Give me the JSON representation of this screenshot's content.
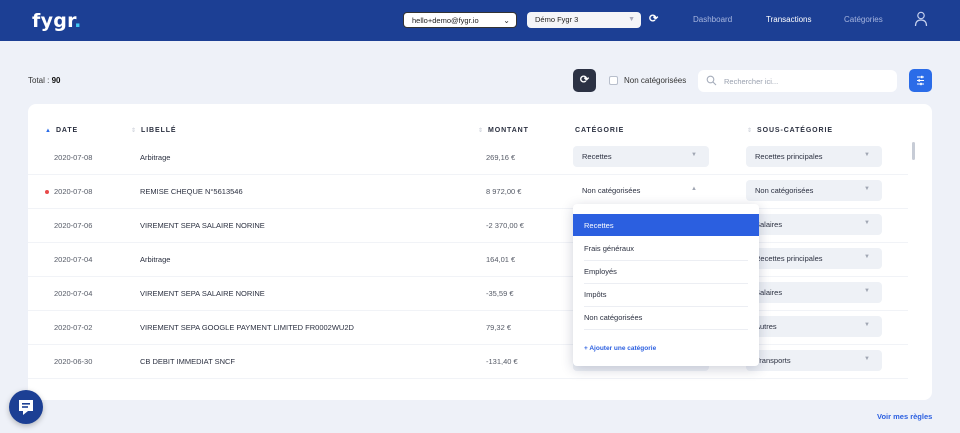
{
  "header": {
    "logo": "fygr",
    "logo_dot": ".",
    "user_select": "hello+demo@fygr.io",
    "org_select": "Démo Fygr 3",
    "nav": [
      "Dashboard",
      "Transactions",
      "Catégories"
    ],
    "active_nav": "Transactions"
  },
  "toolbar": {
    "total_label": "Total :",
    "total_value": "90",
    "uncategorized_label": "Non catégorisées",
    "search_placeholder": "Rechercher ici..."
  },
  "table": {
    "columns": [
      "DATE",
      "LIBELLÉ",
      "MONTANT",
      "CATÉGORIE",
      "SOUS-CATÉGORIE"
    ],
    "rows": [
      {
        "date": "2020-07-08",
        "label": "Arbitrage",
        "amount": "269,16 €",
        "category": "Recettes",
        "subcategory": "Recettes principales"
      },
      {
        "date": "2020-07-08",
        "label": "REMISE CHEQUE N°5613546",
        "amount": "8 972,00 €",
        "category": "Non catégorisées",
        "subcategory": "Non catégorisées"
      },
      {
        "date": "2020-07-06",
        "label": "VIREMENT SEPA SALAIRE NORINE",
        "amount": "-2 370,00 €",
        "category": "",
        "subcategory": "Salaires"
      },
      {
        "date": "2020-07-04",
        "label": "Arbitrage",
        "amount": "164,01 €",
        "category": "",
        "subcategory": "Recettes principales"
      },
      {
        "date": "2020-07-04",
        "label": "VIREMENT SEPA SALAIRE NORINE",
        "amount": "-35,59 €",
        "category": "",
        "subcategory": "Salaires"
      },
      {
        "date": "2020-07-02",
        "label": "VIREMENT SEPA GOOGLE PAYMENT LIMITED FR0002WU2D",
        "amount": "79,32 €",
        "category": "",
        "subcategory": "Autres"
      },
      {
        "date": "2020-06-30",
        "label": "CB DEBIT IMMEDIAT SNCF",
        "amount": "-131,40 €",
        "category": "",
        "subcategory": "Transports"
      }
    ]
  },
  "dropdown": {
    "options": [
      "Recettes",
      "Frais généraux",
      "Employés",
      "Impôts",
      "Non catégorisées"
    ],
    "selected": "Recettes",
    "add_label": "+ Ajouter une catégorie"
  },
  "footer": {
    "rules_link": "Voir mes règles"
  },
  "colors": {
    "header": "#1c3f94",
    "accent": "#2b5fe0",
    "alert_dot": "#e84a4a"
  }
}
